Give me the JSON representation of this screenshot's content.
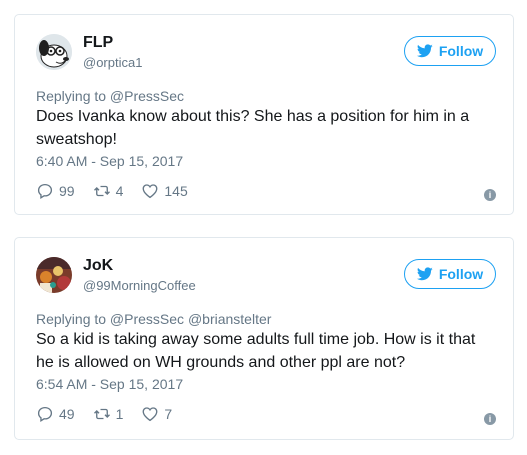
{
  "tweets": [
    {
      "name": "FLP",
      "handle": "@orptica1",
      "follow_label": "Follow",
      "replying_to": "Replying to @PressSec",
      "text": "Does Ivanka know about this? She has a position for him in a sweatshop!",
      "time": "6:40 AM - Sep 15, 2017",
      "replies": "99",
      "retweets": "4",
      "likes": "145",
      "avatar_icon": "cartoon-dog-avatar"
    },
    {
      "name": "JoK",
      "handle": "@99MorningCoffee",
      "follow_label": "Follow",
      "replying_to": "Replying to @PressSec @brianstelter",
      "text": "So a kid is taking away some adults full time job. How is it that he is allowed on WH grounds and other ppl are not?",
      "time": "6:54 AM - Sep 15, 2017",
      "replies": "49",
      "retweets": "1",
      "likes": "7",
      "avatar_icon": "photo-avatar"
    }
  ],
  "colors": {
    "accent": "#1da1f2",
    "muted": "#657786",
    "border": "#e1e8ed"
  }
}
